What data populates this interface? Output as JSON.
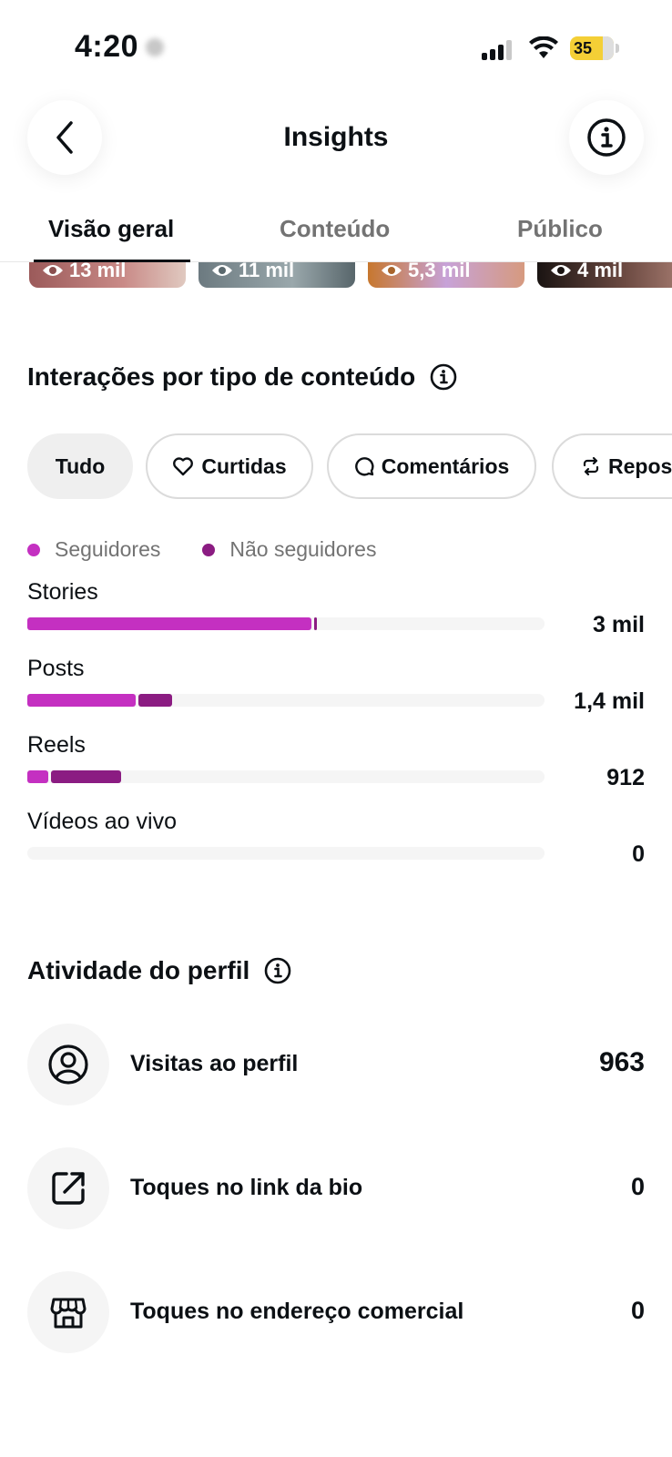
{
  "status_bar": {
    "time": "4:20",
    "battery": "35"
  },
  "header": {
    "title": "Insights"
  },
  "tabs": [
    {
      "label": "Visão geral",
      "active": true
    },
    {
      "label": "Conteúdo",
      "active": false
    },
    {
      "label": "Público",
      "active": false
    }
  ],
  "thumbnails": [
    {
      "views": "13 mil"
    },
    {
      "views": "11 mil"
    },
    {
      "views": "5,3 mil"
    },
    {
      "views": "4 mil"
    }
  ],
  "interactions": {
    "title": "Interações por tipo de conteúdo",
    "filters": [
      {
        "label": "Tudo",
        "selected": true
      },
      {
        "label": "Curtidas",
        "selected": false
      },
      {
        "label": "Comentários",
        "selected": false
      },
      {
        "label": "Reposts",
        "selected": false
      }
    ],
    "legend": [
      {
        "label": "Seguidores",
        "color": "#c430c1"
      },
      {
        "label": "Não seguidores",
        "color": "#8b1c82"
      }
    ],
    "rows": [
      {
        "label": "Stories",
        "value": "3 mil",
        "followers_pct": 0.55,
        "non_followers_pct": 0.005
      },
      {
        "label": "Posts",
        "value": "1,4 mil",
        "followers_pct": 0.21,
        "non_followers_pct": 0.065
      },
      {
        "label": "Reels",
        "value": "912",
        "followers_pct": 0.04,
        "non_followers_pct": 0.135
      },
      {
        "label": "Vídeos ao vivo",
        "value": "0",
        "followers_pct": 0,
        "non_followers_pct": 0
      }
    ]
  },
  "profile_activity": {
    "title": "Atividade do perfil",
    "rows": [
      {
        "label": "Visitas ao perfil",
        "value": "963",
        "icon": "person-circle-icon"
      },
      {
        "label": "Toques no link da bio",
        "value": "0",
        "icon": "external-link-icon"
      },
      {
        "label": "Toques no endereço comercial",
        "value": "0",
        "icon": "storefront-icon"
      }
    ]
  },
  "colors": {
    "followers": "#c430c1",
    "non_followers": "#8b1c82",
    "track": "#f5f5f5"
  }
}
